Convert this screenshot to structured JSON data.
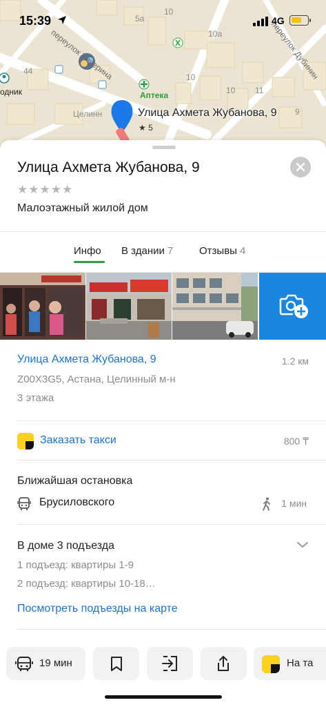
{
  "status_bar": {
    "time": "15:39",
    "network": "4G"
  },
  "map": {
    "streets": [
      "переулок Чичерина",
      "переулок Дубинин"
    ],
    "house_numbers": [
      "5а",
      "10",
      "10а",
      "10",
      "10",
      "11",
      "9",
      "44",
      "5"
    ],
    "district_label": "Целинн",
    "pharmacy": "Аптека",
    "poi_fragment": "одник",
    "pin": {
      "title": "Улица Ахмета Жубанова, 9",
      "rating": "★ 5"
    }
  },
  "card": {
    "title": "Улица Ахмета Жубанова, 9",
    "stars": "★★★★★",
    "stars_filled": 0,
    "subtitle": "Малоэтажный жилой дом",
    "tabs": [
      {
        "label": "Инфо",
        "count": ""
      },
      {
        "label": "В здании",
        "count": "7"
      },
      {
        "label": "Отзывы",
        "count": "4"
      }
    ],
    "active_tab": "Инфо",
    "address": {
      "link": "Улица Ахмета Жубанова, 9",
      "distance": "1.2 км",
      "postal": "Z00X3G5, Астана, Целинный м-н",
      "floors": "3 этажа"
    },
    "taxi": {
      "label": "Заказать такси",
      "price": "800 ₸"
    },
    "stop": {
      "heading": "Ближайшая остановка",
      "name": "Брусиловского",
      "walk_time": "1 мин"
    },
    "entrances": {
      "heading": "В доме 3 подъезда",
      "line1": "1 подъезд: квартиры 1-9",
      "line2": "2 подъезд: квартиры 10-18…",
      "link": "Посмотреть подъезды на карте"
    }
  },
  "bottom_bar": {
    "route_time": "19 мин",
    "taxi_label": "На та"
  },
  "colors": {
    "link": "#1b73d3",
    "accent_green": "#2e9c3f",
    "photo_button": "#1a86e0",
    "pin": "#1a78e8",
    "taxi_yellow": "#ffd21f"
  }
}
